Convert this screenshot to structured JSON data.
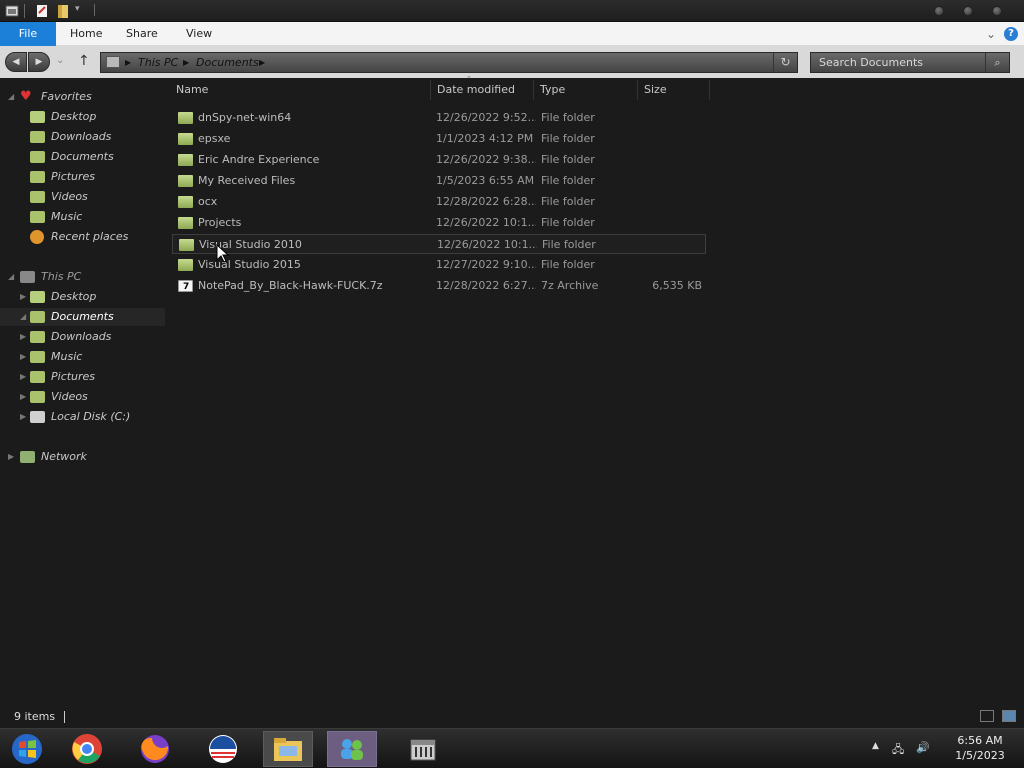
{
  "ribbon": {
    "tabs": [
      {
        "label": "File"
      },
      {
        "label": "Home"
      },
      {
        "label": "Share"
      },
      {
        "label": "View"
      }
    ]
  },
  "address": {
    "crumbs": [
      "This PC",
      "Documents"
    ]
  },
  "search": {
    "placeholder": "Search Documents"
  },
  "sidebar": {
    "favorites_label": "Favorites",
    "favorites": [
      {
        "label": "Desktop",
        "icon": "desktop-icon"
      },
      {
        "label": "Downloads",
        "icon": "downloads-icon"
      },
      {
        "label": "Documents",
        "icon": "documents-icon"
      },
      {
        "label": "Pictures",
        "icon": "pictures-icon"
      },
      {
        "label": "Videos",
        "icon": "videos-icon"
      },
      {
        "label": "Music",
        "icon": "music-icon"
      },
      {
        "label": "Recent places",
        "icon": "recent-places-icon"
      }
    ],
    "thispc_label": "This PC",
    "thispc": [
      {
        "label": "Desktop"
      },
      {
        "label": "Documents"
      },
      {
        "label": "Downloads"
      },
      {
        "label": "Music"
      },
      {
        "label": "Pictures"
      },
      {
        "label": "Videos"
      },
      {
        "label": "Local Disk (C:)"
      }
    ],
    "network_label": "Network"
  },
  "columns": {
    "name": "Name",
    "date": "Date modified",
    "type": "Type",
    "size": "Size"
  },
  "files": [
    {
      "name": "dnSpy-net-win64",
      "date": "12/26/2022 9:52...",
      "type": "File folder",
      "size": ""
    },
    {
      "name": "epsxe",
      "date": "1/1/2023 4:12 PM",
      "type": "File folder",
      "size": ""
    },
    {
      "name": "Eric Andre Experience",
      "date": "12/26/2022 9:38...",
      "type": "File folder",
      "size": ""
    },
    {
      "name": "My Received Files",
      "date": "1/5/2023 6:55 AM",
      "type": "File folder",
      "size": ""
    },
    {
      "name": "ocx",
      "date": "12/28/2022 6:28...",
      "type": "File folder",
      "size": ""
    },
    {
      "name": "Projects",
      "date": "12/26/2022 10:1...",
      "type": "File folder",
      "size": ""
    },
    {
      "name": "Visual Studio 2010",
      "date": "12/26/2022 10:1...",
      "type": "File folder",
      "size": ""
    },
    {
      "name": "Visual Studio 2015",
      "date": "12/27/2022 9:10...",
      "type": "File folder",
      "size": ""
    },
    {
      "name": "NotePad_By_Black-Hawk-FUCK.7z",
      "date": "12/28/2022 6:27...",
      "type": "7z Archive",
      "size": "6,535 KB"
    }
  ],
  "status": {
    "items": "9 items"
  },
  "clock": {
    "time": "6:56 AM",
    "date": "1/5/2023"
  },
  "colors": {
    "file_tab": "#1c7fd8",
    "folder": "#a9c26b",
    "background": "#1b1b1b"
  }
}
